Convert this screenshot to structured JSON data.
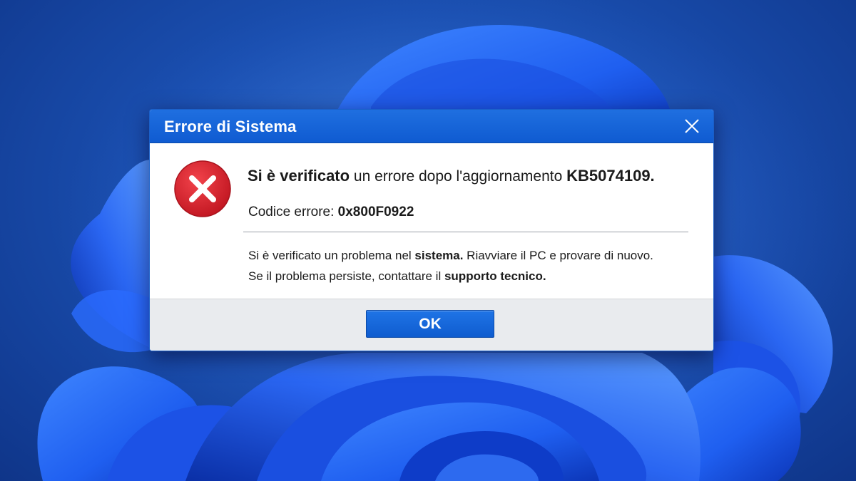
{
  "dialog": {
    "title": "Errore di Sistema",
    "close_icon": "close-icon",
    "error_icon": "error-x-icon",
    "headline_bold": "Si è verificato",
    "headline_regular": " un errore dopo l'aggiornamento ",
    "headline_kb": "KB5074109.",
    "code_label": "Codice errore: ",
    "code_value": "0x800F0922",
    "message_line1_a": "Si è verificato un problema nel ",
    "message_line1_b": "sistema.",
    "message_line1_c": " Riavviare il PC e provare di nuovo.",
    "message_line2_a": "Se il problema persiste, contattare il ",
    "message_line2_b": "supporto tecnico.",
    "ok_label": "OK"
  },
  "colors": {
    "titlebar": "#1464d8",
    "error_red": "#d9232e",
    "desktop_blue": "#1a4fb0"
  }
}
